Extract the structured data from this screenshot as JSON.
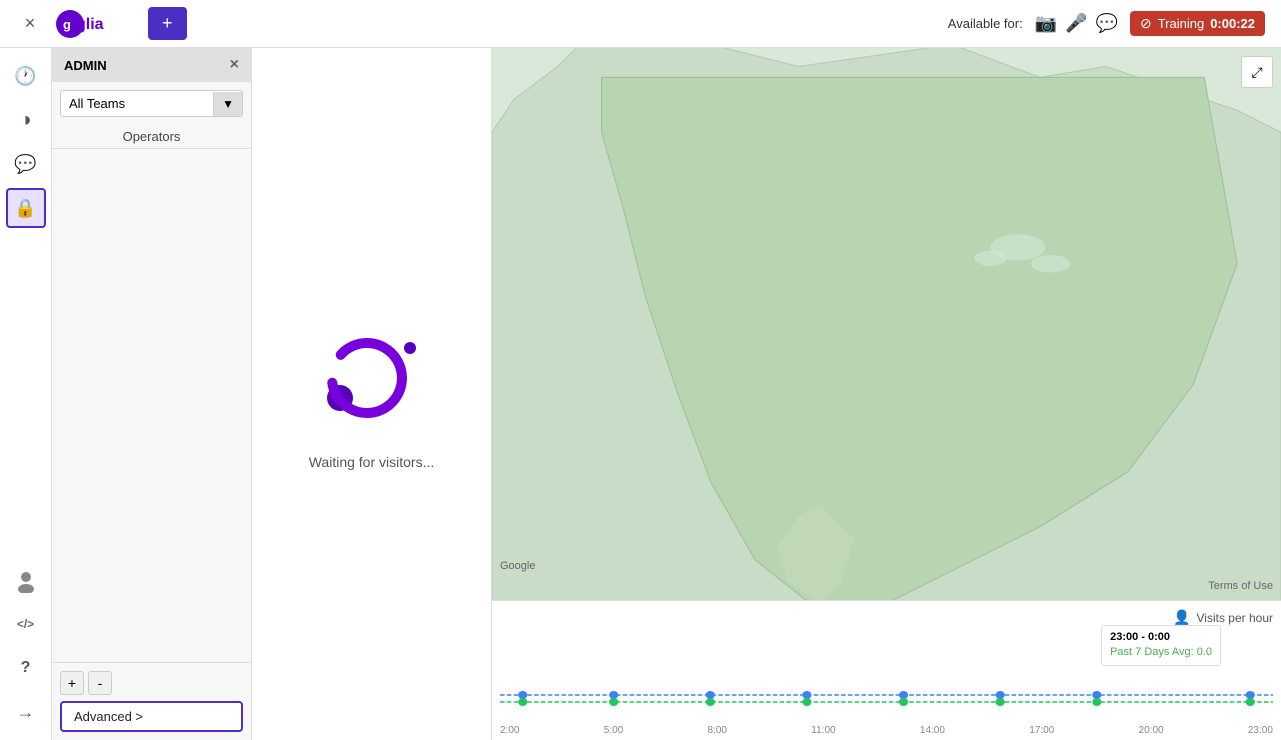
{
  "header": {
    "close_label": "×",
    "logo_text": "glia",
    "add_button_label": "+",
    "available_label": "Available for:",
    "training_label": "Training",
    "training_time": "0:00:22",
    "media_icons": [
      "camera",
      "microphone",
      "chat"
    ]
  },
  "sidebar": {
    "icons": [
      {
        "name": "clock-icon",
        "symbol": "🕐",
        "active": false
      },
      {
        "name": "chart-icon",
        "symbol": "◑",
        "active": false
      },
      {
        "name": "chat-icon",
        "symbol": "💬",
        "active": false
      },
      {
        "name": "lock-icon",
        "symbol": "🔒",
        "active": true
      },
      {
        "name": "avatar-icon",
        "symbol": "👤",
        "active": false
      },
      {
        "name": "code-icon",
        "symbol": "</>",
        "active": false
      },
      {
        "name": "question-icon",
        "symbol": "?",
        "active": false
      },
      {
        "name": "exit-icon",
        "symbol": "→",
        "active": false
      }
    ]
  },
  "admin": {
    "title": "ADMIN",
    "close_label": "×",
    "teams_label": "All Teams",
    "operators_label": "Operators",
    "zoom_plus": "+",
    "zoom_minus": "-",
    "advanced_label": "Advanced >"
  },
  "visitors": {
    "waiting_text": "Waiting for visitors..."
  },
  "map": {
    "expand_label": "⤢",
    "google_label": "Google",
    "terms_label": "Terms of Use"
  },
  "chart": {
    "visits_label": "Visits per hour",
    "tooltip": {
      "time": "23:00 - 0:00",
      "avg_label": "Past 7 Days Avg: 0.0"
    },
    "x_axis_labels": [
      "2:00",
      "5:00",
      "8:00",
      "11:00",
      "14:00",
      "17:00",
      "20:00",
      "23:00"
    ]
  }
}
